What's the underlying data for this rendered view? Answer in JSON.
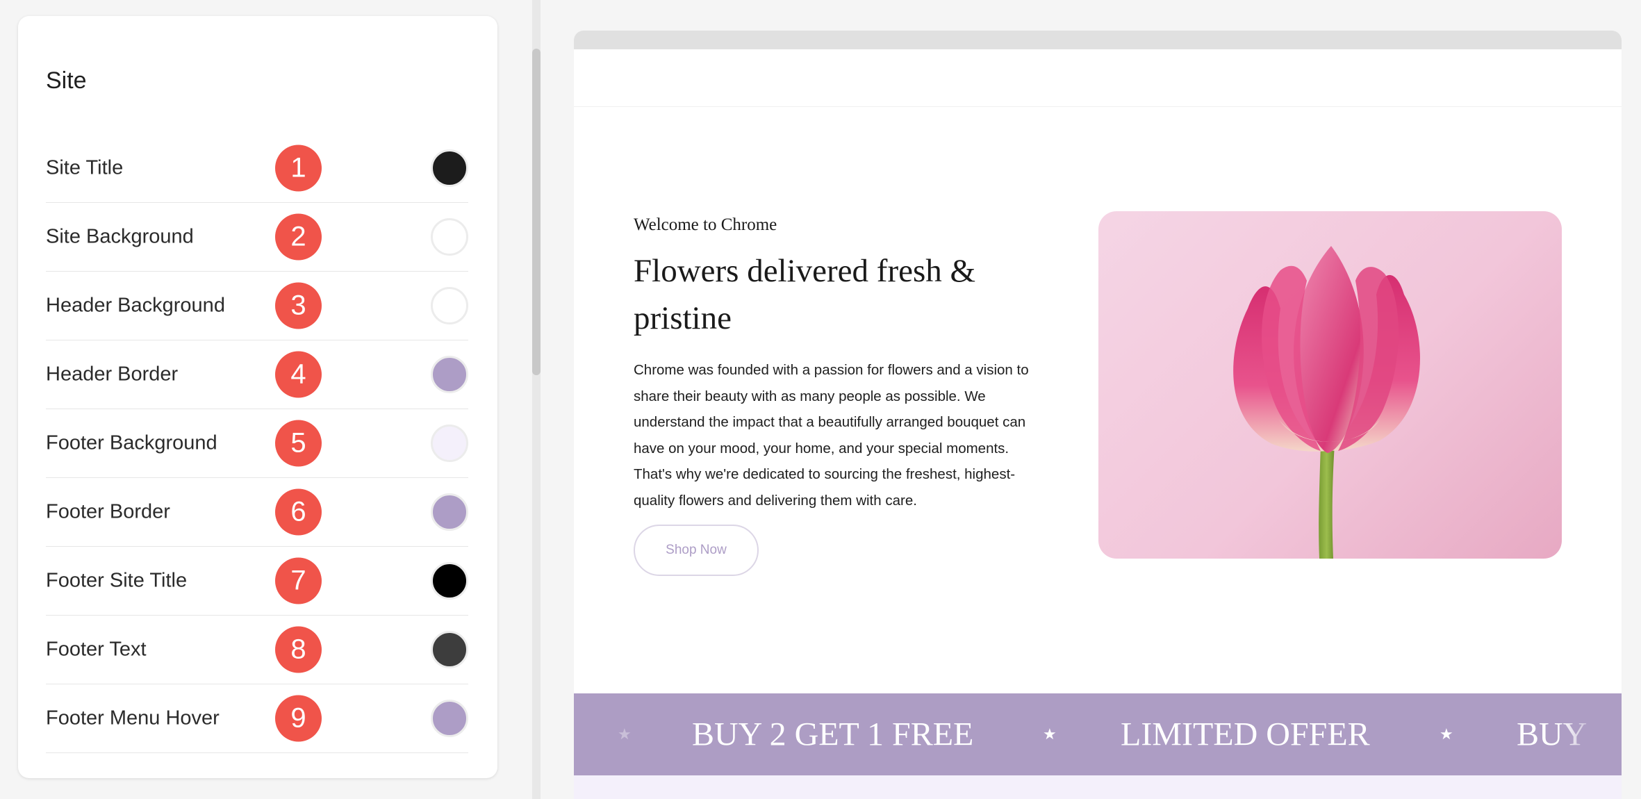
{
  "panel": {
    "title": "Site",
    "rows": [
      {
        "label": "Site Title",
        "badge": "1",
        "color": "#1c1c1c"
      },
      {
        "label": "Site Background",
        "badge": "2",
        "color": "#ffffff"
      },
      {
        "label": "Header Background",
        "badge": "3",
        "color": "#ffffff"
      },
      {
        "label": "Header Border",
        "badge": "4",
        "color": "#ad9dc6"
      },
      {
        "label": "Footer Background",
        "badge": "5",
        "color": "#f4f0fb"
      },
      {
        "label": "Footer Border",
        "badge": "6",
        "color": "#ad9dc6"
      },
      {
        "label": "Footer Site Title",
        "badge": "7",
        "color": "#000000"
      },
      {
        "label": "Footer Text",
        "badge": "8",
        "color": "#3d3d3d"
      },
      {
        "label": "Footer Menu Hover",
        "badge": "9",
        "color": "#ad9dc6"
      }
    ]
  },
  "preview": {
    "welcome": "Welcome to Chrome",
    "title": "Flowers delivered fresh & pristine",
    "body": "Chrome was founded with a passion for flowers and a vision to share their beauty with as many people as possible. We understand the impact that a beautifully arranged bouquet can have on your mood, your home, and your special moments. That's why we're dedicated to sourcing the freshest, highest-quality flowers and delivering them with care.",
    "button": "Shop Now",
    "ticker": {
      "item_1": "BUY 2 GET 1 FREE",
      "item_2": "LIMITED OFFER",
      "item_3": "BUY",
      "star": "★"
    }
  },
  "colors": {
    "badge": "#f0544a",
    "accent": "#ad9dc4",
    "footer_bg": "#f4f0fb"
  },
  "icons": {
    "hero_image": "tulip-icon",
    "separator": "star-icon"
  }
}
